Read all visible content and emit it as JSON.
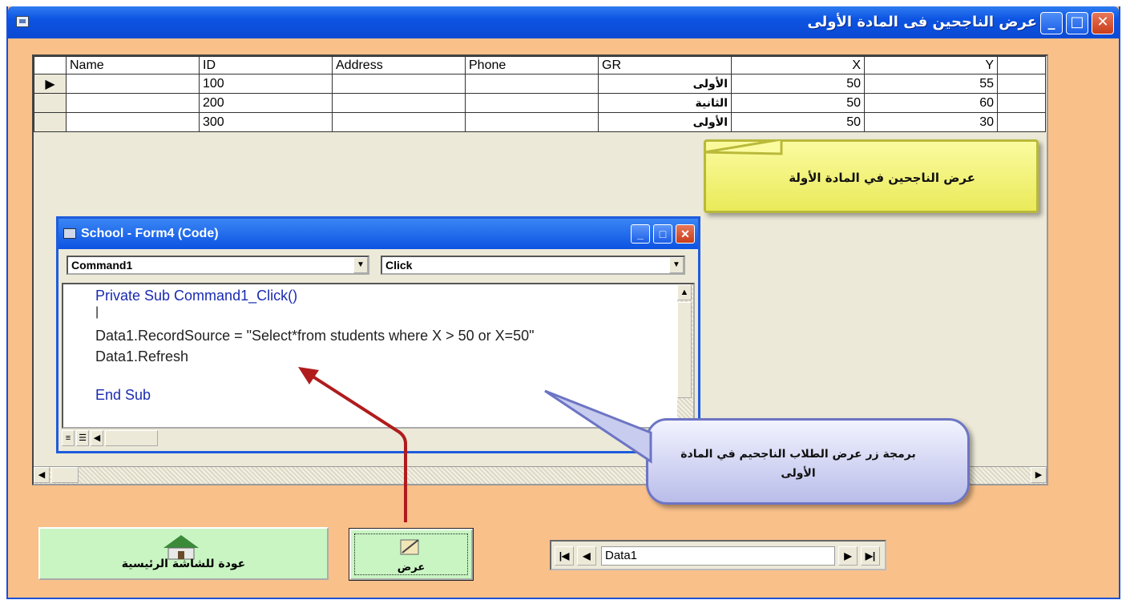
{
  "window": {
    "title": "عرض الناجحين فى المادة الأولى",
    "minimize_glyph": "_",
    "maximize_glyph": "□",
    "close_glyph": "✕"
  },
  "grid": {
    "columns": [
      "Name",
      "ID",
      "Address",
      "Phone",
      "GR",
      "X",
      "Y"
    ],
    "rows": [
      {
        "name": "",
        "id": "100",
        "address": "",
        "phone": "",
        "gr": "الأولى",
        "x": "50",
        "y": "55"
      },
      {
        "name": "",
        "id": "200",
        "address": "",
        "phone": "",
        "gr": "الثانية",
        "x": "50",
        "y": "60"
      },
      {
        "name": "",
        "id": "300",
        "address": "",
        "phone": "",
        "gr": "الأولى",
        "x": "50",
        "y": "30"
      }
    ],
    "selected_row_marker": "▶"
  },
  "code_window": {
    "title": "School - Form4 (Code)",
    "object_combo": "Command1",
    "procedure_combo": "Click",
    "lines": [
      "Private Sub Command1_Click()",
      "|",
      "Data1.RecordSource = \"Select*from students where X > 50 or X=50\"",
      "Data1.Refresh",
      "",
      "End Sub"
    ]
  },
  "callouts": {
    "yellow": "عرض الناجحين في المادة الأولة",
    "blue": "برمجة زر عرض الطلاب الناجحيم في المادة الأولى"
  },
  "buttons": {
    "home_label": "عودة للشاشة الرئيسية",
    "show_label": "عرض"
  },
  "data_control": {
    "caption": "Data1",
    "first_glyph": "|◀",
    "prev_glyph": "◀",
    "next_glyph": "▶",
    "last_glyph": "▶|"
  },
  "colors": {
    "form_background": "#f9c08a",
    "title_bar": "#0d54e3",
    "button_background": "#c8f5c2",
    "arrow": "#b01c1c"
  }
}
